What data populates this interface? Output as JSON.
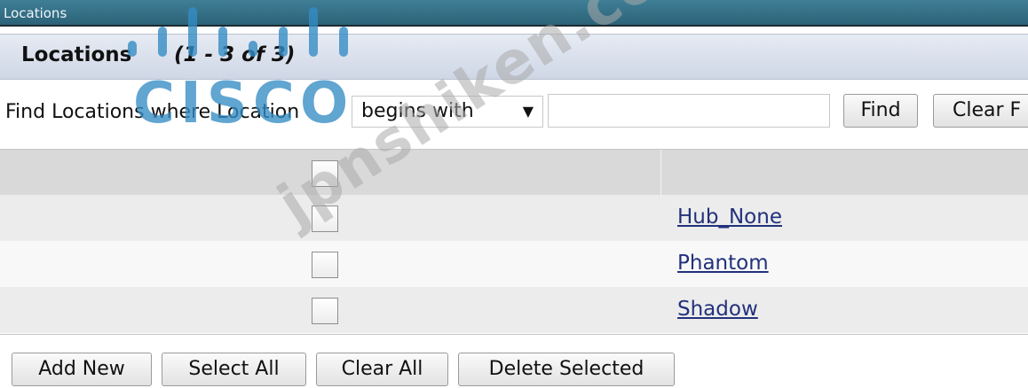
{
  "window": {
    "title": "Locations"
  },
  "panel": {
    "title": "Locations",
    "count": "(1 - 3 of 3)"
  },
  "search": {
    "label": "Find Locations where Location",
    "operator": "begins with",
    "value": "",
    "placeholder": "",
    "find_label": "Find",
    "clear_label": "Clear F"
  },
  "table": {
    "rows": [
      {
        "name": "Hub_None",
        "checked": false
      },
      {
        "name": "Phantom",
        "checked": false
      },
      {
        "name": "Shadow",
        "checked": false
      }
    ]
  },
  "actions": {
    "add_new": "Add New",
    "select_all": "Select All",
    "clear_all": "Clear All",
    "delete_selected": "Delete Selected"
  },
  "overlay": {
    "logo_text": "CISCO",
    "watermark_text": "jpnshiken.com"
  },
  "colors": {
    "titlebar": "#2c6278",
    "link": "#22317c",
    "logo": "#348cc4"
  }
}
